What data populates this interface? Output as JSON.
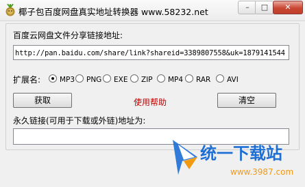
{
  "window": {
    "title": "椰子包百度网盘真实地址转换器 www.58232.net",
    "minimize_symbol": "–",
    "restore_symbol": "□",
    "close_symbol": "✕"
  },
  "form": {
    "share_label": "百度云网盘文件分享链接地址:",
    "share_url": "http://pan.baidu.com/share/link?shareid=3389807558&uk=1879141544",
    "ext_label": "扩展名:",
    "ext_options": [
      {
        "label": "MP3",
        "checked": true
      },
      {
        "label": "PNG",
        "checked": false
      },
      {
        "label": "EXE",
        "checked": false
      },
      {
        "label": "ZIP",
        "checked": false
      },
      {
        "label": "MP4",
        "checked": false
      },
      {
        "label": "RAR",
        "checked": false
      },
      {
        "label": "AVI",
        "checked": false
      }
    ],
    "get_button": "获取",
    "help_link": "使用帮助",
    "clear_button": "清空",
    "result_label": "永久链接(可用于下载或外链)地址为:",
    "result_value": ""
  },
  "watermark": {
    "brand_text": "统一下载站",
    "url_text": "www.3987.com"
  },
  "colors": {
    "accent_red": "#c00000",
    "watermark_blue": "#1d6fd6",
    "watermark_orange": "#f29a12"
  }
}
